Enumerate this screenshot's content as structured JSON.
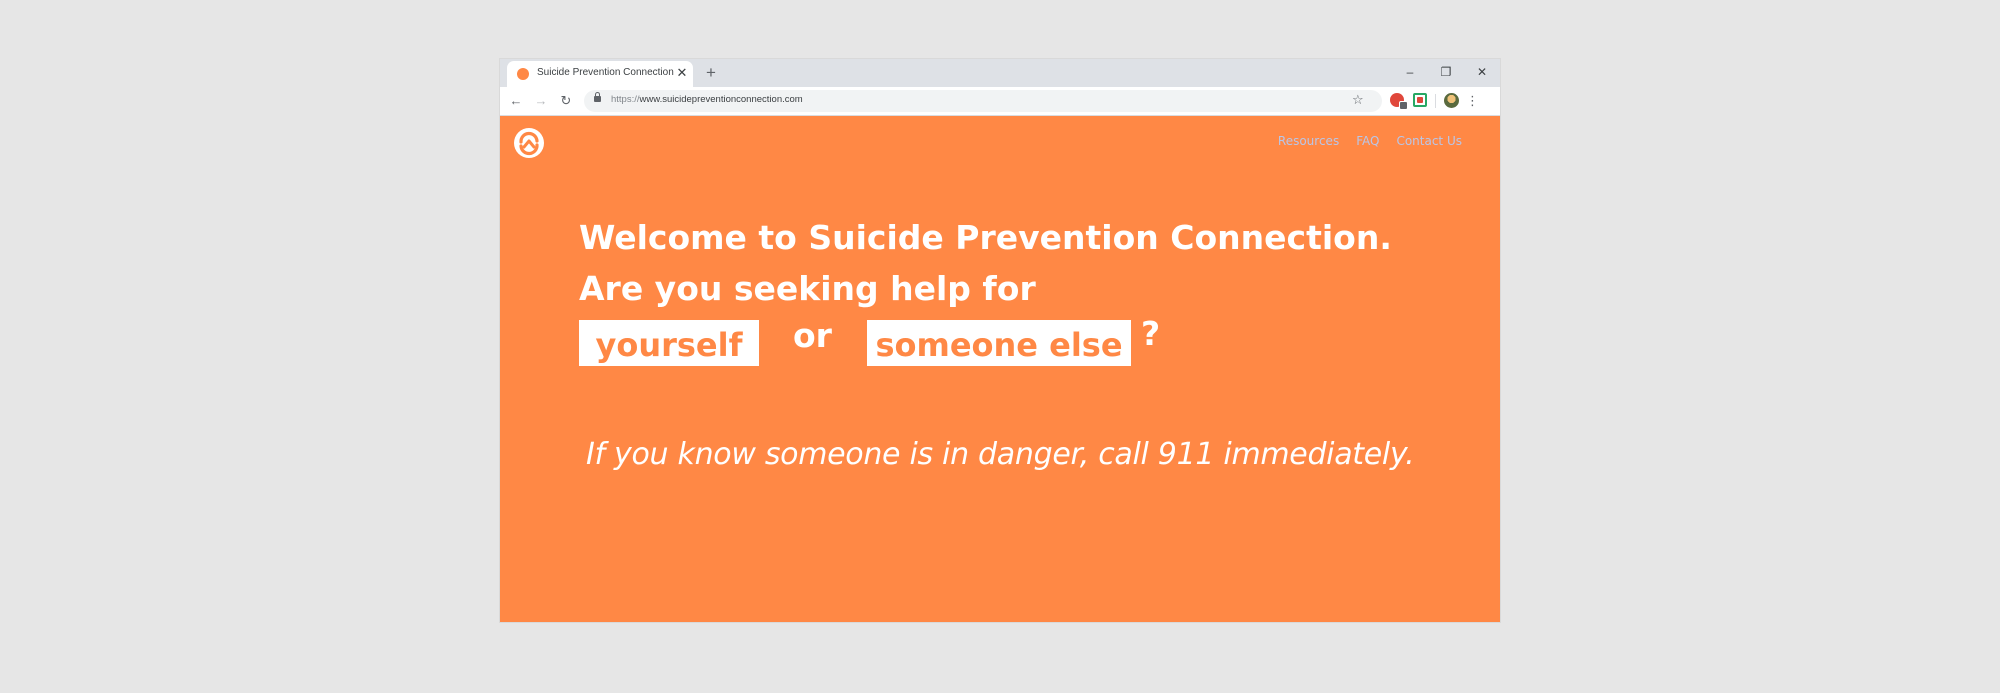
{
  "browser": {
    "tab": {
      "title": "Suicide Prevention Connection",
      "favicon": "orange-circle-icon",
      "close_glyph": "✕"
    },
    "new_tab_glyph": "+",
    "window_controls": {
      "minimize": "–",
      "maximize": "❐",
      "close": "✕"
    },
    "address": {
      "scheme": "https://",
      "host_path": "www.suicidepreventionconnection.com"
    },
    "icons": {
      "back": "←",
      "forward": "→",
      "reload": "↻",
      "bookmark": "☆",
      "menu": "⋮"
    }
  },
  "site": {
    "brand_color": "#ff8845",
    "nav": [
      {
        "label": "Resources"
      },
      {
        "label": "FAQ"
      },
      {
        "label": "Contact Us"
      }
    ],
    "hero": {
      "line1": "Welcome to Suicide Prevention Connection.",
      "line2": "Are you seeking help for",
      "option_self": "yourself",
      "connector": "or",
      "option_other": "someone else",
      "question_mark": "?"
    },
    "emergency_notice": "If you know someone is in danger, call 911 immediately."
  }
}
